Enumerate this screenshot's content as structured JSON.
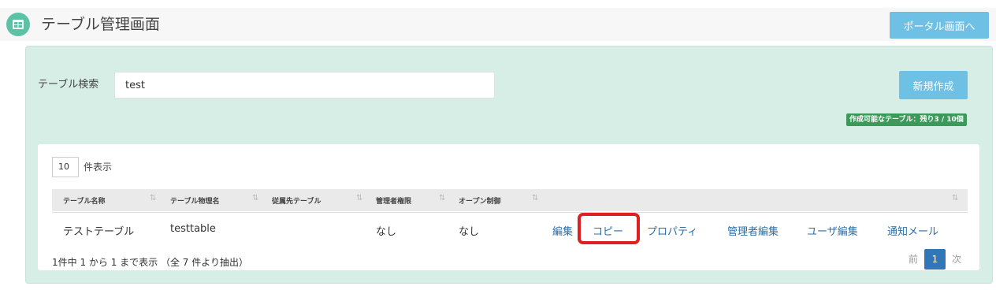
{
  "header": {
    "title": "テーブル管理画面",
    "portal_button": "ポータル画面へ",
    "icon": "table-icon"
  },
  "search": {
    "label": "テーブル検索",
    "value": "test"
  },
  "actions": {
    "new_button": "新規作成",
    "quota_badge": "作成可能なテーブル：残り3 / 10個"
  },
  "table": {
    "page_length": "10",
    "page_length_label": "件表示",
    "columns": [
      "テーブル名称",
      "テーブル物理名",
      "従属先テーブル",
      "管理者権限",
      "オープン制御"
    ],
    "rows": [
      {
        "name": "テストテーブル",
        "physical_name": "testtable",
        "parent_table": "",
        "admin_permission": "なし",
        "open_control": "なし",
        "actions": [
          "編集",
          "コピー",
          "プロパティ",
          "管理者編集",
          "ユーザ編集",
          "通知メール"
        ]
      }
    ],
    "info": "1件中 1 から 1 まで表示 （全 7 件より抽出）",
    "pagination": {
      "prev": "前",
      "current": "1",
      "next": "次"
    }
  },
  "colors": {
    "accent": "#6ec1e4",
    "panel_bg": "#d7eee7",
    "badge_bg": "#3b9a5a",
    "link": "#2e6da4",
    "highlight": "#e02020"
  }
}
